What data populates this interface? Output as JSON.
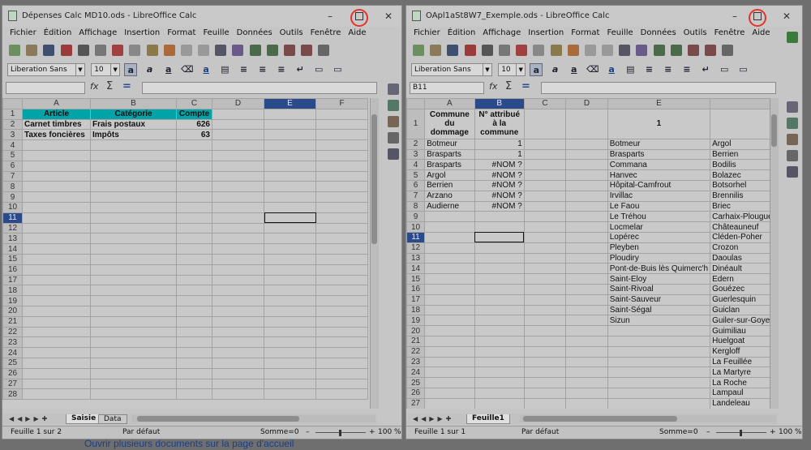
{
  "left_window": {
    "title": "Dépenses Calc MD10.ods - LibreOffice Calc",
    "menus": [
      "Fichier",
      "Édition",
      "Affichage",
      "Insertion",
      "Format",
      "Feuille",
      "Données",
      "Outils",
      "Fenêtre",
      "Aide"
    ],
    "font_name": "Liberation Sans",
    "font_size": "10",
    "name_box": "",
    "columns": [
      "A",
      "B",
      "C",
      "D",
      "E",
      "F"
    ],
    "selected_column": "E",
    "current_row": "11",
    "rows": [
      [
        "Article",
        "Catégorie",
        "Compte",
        "",
        "",
        ""
      ],
      [
        "Carnet timbres",
        "Frais postaux",
        "626",
        "",
        "",
        ""
      ],
      [
        "Taxes foncières",
        "Impôts",
        "63",
        "",
        "",
        ""
      ]
    ],
    "row_count": 28,
    "sheet_tabs": [
      "Saisie",
      "Data"
    ],
    "active_tab": "Saisie",
    "status": {
      "sheet": "Feuille 1 sur 2",
      "style": "Par défaut",
      "sum": "Somme=0",
      "zoom": "100 %"
    }
  },
  "right_window": {
    "title": "OApl1aSt8W7_Exemple.ods - LibreOffice Calc",
    "menus": [
      "Fichier",
      "Édition",
      "Affichage",
      "Insertion",
      "Format",
      "Feuille",
      "Données",
      "Outils",
      "Fenêtre",
      "Aide"
    ],
    "font_name": "Liberation Sans",
    "font_size": "10",
    "name_box": "B11",
    "columns": [
      "A",
      "B",
      "C",
      "D",
      "E",
      ""
    ],
    "selected_column": "B",
    "current_row": "11",
    "header_row": [
      "Commune du dommage",
      "N° attribué à la commune",
      "",
      "",
      "1",
      ""
    ],
    "rows": [
      [
        "Botmeur",
        "1",
        "",
        "",
        "Botmeur",
        "Argol"
      ],
      [
        "Brasparts",
        "1",
        "",
        "",
        "Brasparts",
        "Berrien"
      ],
      [
        "Brasparts",
        "#NOM ?",
        "",
        "",
        "Commana",
        "Bodilis"
      ],
      [
        "Argol",
        "#NOM ?",
        "",
        "",
        "Hanvec",
        "Bolazec"
      ],
      [
        "Berrien",
        "#NOM ?",
        "",
        "",
        "Hôpital-Camfrout",
        "Botsorhel"
      ],
      [
        "Arzano",
        "#NOM ?",
        "",
        "",
        "Irvillac",
        "Brennilis"
      ],
      [
        "Audierne",
        "#NOM ?",
        "",
        "",
        "Le Faou",
        "Briec"
      ],
      [
        "",
        "",
        "",
        "",
        "Le Tréhou",
        "Carhaix-Plouguer"
      ],
      [
        "",
        "",
        "",
        "",
        "Locmelar",
        "Châteauneuf"
      ],
      [
        "",
        "",
        "",
        "",
        "Lopérec",
        "Cléden-Poher"
      ],
      [
        "",
        "",
        "",
        "",
        "Pleyben",
        "Crozon"
      ],
      [
        "",
        "",
        "",
        "",
        "Ploudiry",
        "Daoulas"
      ],
      [
        "",
        "",
        "",
        "",
        "Pont-de-Buis lès Quimerc'h",
        "Dinéault"
      ],
      [
        "",
        "",
        "",
        "",
        "Saint-Eloy",
        "Edern"
      ],
      [
        "",
        "",
        "",
        "",
        "Saint-Rivoal",
        "Gouézec"
      ],
      [
        "",
        "",
        "",
        "",
        "Saint-Sauveur",
        "Guerlesquin"
      ],
      [
        "",
        "",
        "",
        "",
        "Saint-Ségal",
        "Guiclan"
      ],
      [
        "",
        "",
        "",
        "",
        "Sizun",
        "Guiler-sur-Goyen"
      ],
      [
        "",
        "",
        "",
        "",
        "",
        "Guimiliau"
      ],
      [
        "",
        "",
        "",
        "",
        "",
        "Huelgoat"
      ],
      [
        "",
        "",
        "",
        "",
        "",
        "Kergloff"
      ],
      [
        "",
        "",
        "",
        "",
        "",
        "La Feuillée"
      ],
      [
        "",
        "",
        "",
        "",
        "",
        "La Martyre"
      ],
      [
        "",
        "",
        "",
        "",
        "",
        "La Roche"
      ],
      [
        "",
        "",
        "",
        "",
        "",
        "Lampaul"
      ],
      [
        "",
        "",
        "",
        "",
        "",
        "Landeleau"
      ]
    ],
    "sheet_tabs": [
      "Feuille1"
    ],
    "active_tab": "Feuille1",
    "status": {
      "sheet": "Feuille 1 sur 1",
      "style": "Par défaut",
      "sum": "Somme=0",
      "zoom": "100 %"
    }
  },
  "background_text": "Ouvrir plusieurs documents sur la page d'accueil",
  "colors": {
    "header_fill": "#00a3a8",
    "selected_header": "#2a4a8a",
    "highlight_ring": "#e6332a"
  }
}
